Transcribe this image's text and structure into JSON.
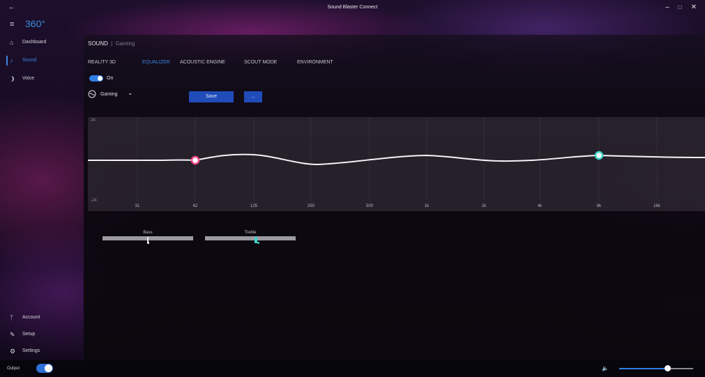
{
  "window": {
    "title": "Sound Blaster Connect",
    "icons": {
      "back": "back-arrow-icon",
      "minimize": "minimize-icon",
      "maximize": "maximize-icon",
      "close": "close-icon"
    }
  },
  "brand": {
    "name": "360°",
    "menu_icon": "hamburger-icon"
  },
  "sidebar": {
    "top_items": [
      {
        "label": "Dashboard",
        "icon": "home-icon"
      },
      {
        "label": "Sound",
        "icon": "music-note-icon",
        "active": true
      },
      {
        "label": "Voice",
        "icon": "voice-icon"
      }
    ],
    "bottom_items": [
      {
        "label": "Account",
        "icon": "person-icon"
      },
      {
        "label": "Setup",
        "icon": "wrench-icon"
      },
      {
        "label": "Settings",
        "icon": "gear-icon"
      }
    ]
  },
  "breadcrumb": {
    "section": "SOUND",
    "separator": "|",
    "profile": "Gaming"
  },
  "tabs": [
    {
      "label": "REALITY 3D"
    },
    {
      "label": "EQUALIZER",
      "active": true
    },
    {
      "label": "ACOUSTIC ENGINE"
    },
    {
      "label": "SCOUT MODE"
    },
    {
      "label": "ENVIRONMENT"
    }
  ],
  "equalizer": {
    "toggle_label": "On",
    "toggle_on": true,
    "preset": "Gaming",
    "save_label": "Save",
    "more_label": "...",
    "db_max": "24",
    "db_min": "-24",
    "frequencies": [
      "31",
      "62",
      "125",
      "250",
      "500",
      "1k",
      "2k",
      "4k",
      "8k",
      "16k"
    ],
    "bass_handle": {
      "frequency": "62",
      "color": "#ff4d8a"
    },
    "treble_handle": {
      "frequency": "8k",
      "color": "#3fd3c6"
    }
  },
  "tone_controls": {
    "bass": {
      "label": "Bass",
      "level": 0.5,
      "accent": "#ffffff"
    },
    "treble": {
      "label": "Treble",
      "level": 0.55,
      "accent": "#3fd3c6"
    }
  },
  "bottom_bar": {
    "output_label": "Output",
    "output_on": true,
    "volume_icon": "speaker-icon",
    "volume_level": 0.65
  },
  "colors": {
    "accent": "#3b86e0",
    "button": "#1f4cb9"
  }
}
